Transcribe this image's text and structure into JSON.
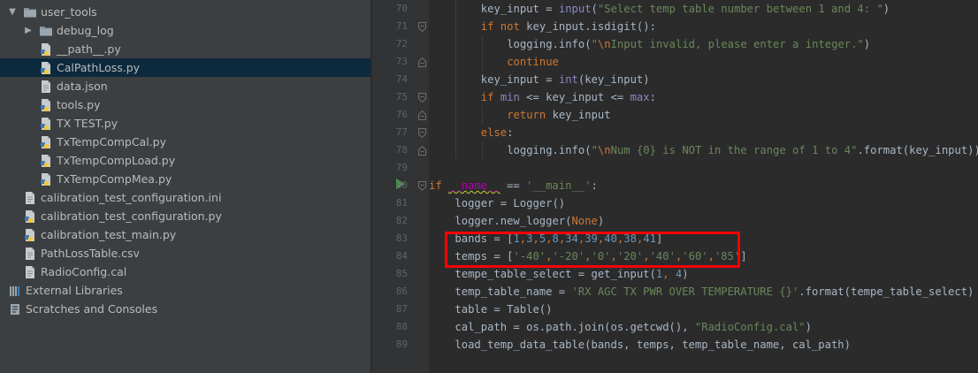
{
  "project_tree": {
    "items": [
      {
        "label": "user_tools",
        "type": "folder",
        "depth": 0,
        "expanded": true
      },
      {
        "label": "debug_log",
        "type": "folder",
        "depth": 1,
        "expanded": false
      },
      {
        "label": "__path__.py",
        "type": "py",
        "depth": 1
      },
      {
        "label": "CalPathLoss.py",
        "type": "py",
        "depth": 1,
        "selected": true
      },
      {
        "label": "data.json",
        "type": "file",
        "depth": 1
      },
      {
        "label": "tools.py",
        "type": "py",
        "depth": 1
      },
      {
        "label": "TX TEST.py",
        "type": "py",
        "depth": 1
      },
      {
        "label": "TxTempCompCal.py",
        "type": "py",
        "depth": 1
      },
      {
        "label": "TxTempCompLoad.py",
        "type": "py",
        "depth": 1
      },
      {
        "label": "TxTempCompMea.py",
        "type": "py",
        "depth": 1
      },
      {
        "label": "calibration_test_configuration.ini",
        "type": "file",
        "depth": 0
      },
      {
        "label": "calibration_test_configuration.py",
        "type": "py",
        "depth": 0
      },
      {
        "label": "calibration_test_main.py",
        "type": "py",
        "depth": 0
      },
      {
        "label": "PathLossTable.csv",
        "type": "file",
        "depth": 0
      },
      {
        "label": "RadioConfig.cal",
        "type": "file",
        "depth": 0
      },
      {
        "label": "External Libraries",
        "type": "library",
        "depth": -1
      },
      {
        "label": "Scratches and Consoles",
        "type": "scratch",
        "depth": -1
      }
    ]
  },
  "editor": {
    "lines": [
      {
        "no": "70",
        "indent": 2,
        "segments": [
          [
            "t",
            "key_input = "
          ],
          [
            "bi",
            "input"
          ],
          [
            "t",
            "("
          ],
          [
            "str",
            "\"Select temp table number between 1 and 4: \""
          ],
          [
            "t",
            ")"
          ]
        ]
      },
      {
        "no": "71",
        "indent": 2,
        "fold": "open",
        "segments": [
          [
            "kw",
            "if not "
          ],
          [
            "t",
            "key_input.isdigit():"
          ]
        ]
      },
      {
        "no": "72",
        "indent": 3,
        "segments": [
          [
            "t",
            "logging.info("
          ],
          [
            "str",
            "\""
          ],
          [
            "esc",
            "\\n"
          ],
          [
            "str",
            "Input invalid, please enter a integer.\""
          ],
          [
            "t",
            ")"
          ]
        ]
      },
      {
        "no": "73",
        "indent": 3,
        "fold": "close",
        "segments": [
          [
            "kw",
            "continue"
          ]
        ]
      },
      {
        "no": "74",
        "indent": 2,
        "segments": [
          [
            "t",
            "key_input = "
          ],
          [
            "bi",
            "int"
          ],
          [
            "t",
            "(key_input)"
          ]
        ]
      },
      {
        "no": "75",
        "indent": 2,
        "fold": "open",
        "segments": [
          [
            "kw",
            "if "
          ],
          [
            "bi",
            "min"
          ],
          [
            "t",
            " <= key_input <= "
          ],
          [
            "bi",
            "max"
          ],
          [
            "t",
            ":"
          ]
        ]
      },
      {
        "no": "76",
        "indent": 3,
        "fold": "close",
        "segments": [
          [
            "kw",
            "return "
          ],
          [
            "t",
            "key_input"
          ]
        ]
      },
      {
        "no": "77",
        "indent": 2,
        "fold": "open",
        "segments": [
          [
            "kw",
            "else"
          ],
          [
            "t",
            ":"
          ]
        ]
      },
      {
        "no": "78",
        "indent": 3,
        "fold": "close",
        "segments": [
          [
            "t",
            "logging.info("
          ],
          [
            "str",
            "\""
          ],
          [
            "esc",
            "\\n"
          ],
          [
            "str",
            "Num {0} is NOT in the range of 1 to 4\""
          ],
          [
            "t",
            ".format(key_input))"
          ]
        ]
      },
      {
        "no": "79",
        "indent": 0,
        "segments": []
      },
      {
        "no": "80",
        "indent": 0,
        "fold": "open",
        "run": true,
        "segments": [
          [
            "kw",
            "if "
          ],
          [
            "dunder",
            "__name__"
          ],
          [
            "t",
            " == "
          ],
          [
            "str",
            "'__main__'"
          ],
          [
            "t",
            ":"
          ]
        ]
      },
      {
        "no": "81",
        "indent": 1,
        "segments": [
          [
            "t",
            "logger = Logger()"
          ]
        ]
      },
      {
        "no": "82",
        "indent": 1,
        "segments": [
          [
            "t",
            "logger.new_logger("
          ],
          [
            "kw",
            "None"
          ],
          [
            "t",
            ")"
          ]
        ]
      },
      {
        "no": "83",
        "indent": 1,
        "segments": [
          [
            "t",
            "bands = ["
          ],
          [
            "num",
            "1"
          ],
          [
            "kw",
            ","
          ],
          [
            "num",
            "3"
          ],
          [
            "kw",
            ","
          ],
          [
            "num",
            "5"
          ],
          [
            "kw",
            ","
          ],
          [
            "num",
            "8"
          ],
          [
            "kw",
            ","
          ],
          [
            "num",
            "34"
          ],
          [
            "kw",
            ","
          ],
          [
            "num",
            "39"
          ],
          [
            "kw",
            ","
          ],
          [
            "num",
            "40"
          ],
          [
            "kw",
            ","
          ],
          [
            "num",
            "38"
          ],
          [
            "kw",
            ","
          ],
          [
            "num",
            "41"
          ],
          [
            "t",
            "]"
          ]
        ]
      },
      {
        "no": "84",
        "indent": 1,
        "segments": [
          [
            "t",
            "temps = ["
          ],
          [
            "str",
            "'-40'"
          ],
          [
            "kw",
            ","
          ],
          [
            "str",
            "'-20'"
          ],
          [
            "kw",
            ","
          ],
          [
            "str",
            "'0'"
          ],
          [
            "kw",
            ","
          ],
          [
            "str",
            "'20'"
          ],
          [
            "kw",
            ","
          ],
          [
            "str",
            "'40'"
          ],
          [
            "kw",
            ","
          ],
          [
            "str",
            "'60'"
          ],
          [
            "kw",
            ","
          ],
          [
            "str",
            "'85'"
          ],
          [
            "t",
            "]"
          ]
        ]
      },
      {
        "no": "85",
        "indent": 1,
        "segments": [
          [
            "t",
            "tempe_table_select = get_input("
          ],
          [
            "num",
            "1"
          ],
          [
            "kw",
            ", "
          ],
          [
            "num",
            "4"
          ],
          [
            "t",
            ")"
          ]
        ]
      },
      {
        "no": "86",
        "indent": 1,
        "segments": [
          [
            "t",
            "temp_table_name = "
          ],
          [
            "str",
            "'RX AGC TX PWR OVER TEMPERATURE {}'"
          ],
          [
            "t",
            ".format(tempe_table_select)"
          ]
        ]
      },
      {
        "no": "87",
        "indent": 1,
        "segments": [
          [
            "t",
            "table = Table()"
          ]
        ]
      },
      {
        "no": "88",
        "indent": 1,
        "segments": [
          [
            "t",
            "cal_path = os.path.join(os.getcwd(), "
          ],
          [
            "str",
            "\"RadioConfig.cal\""
          ],
          [
            "t",
            ")"
          ]
        ]
      },
      {
        "no": "89",
        "indent": 1,
        "segments": [
          [
            "t",
            "load_temp_data_table(bands, temps, temp_table_name, cal_path)"
          ]
        ]
      }
    ]
  },
  "colors": {
    "panel_bg": "#3c3f41",
    "editor_bg": "#2b2b2b",
    "gutter_bg": "#313335",
    "selection_bg": "#0d293e",
    "highlight_box": "#ff0000",
    "run_icon": "#499c54",
    "folder_icon": "#87939a"
  }
}
